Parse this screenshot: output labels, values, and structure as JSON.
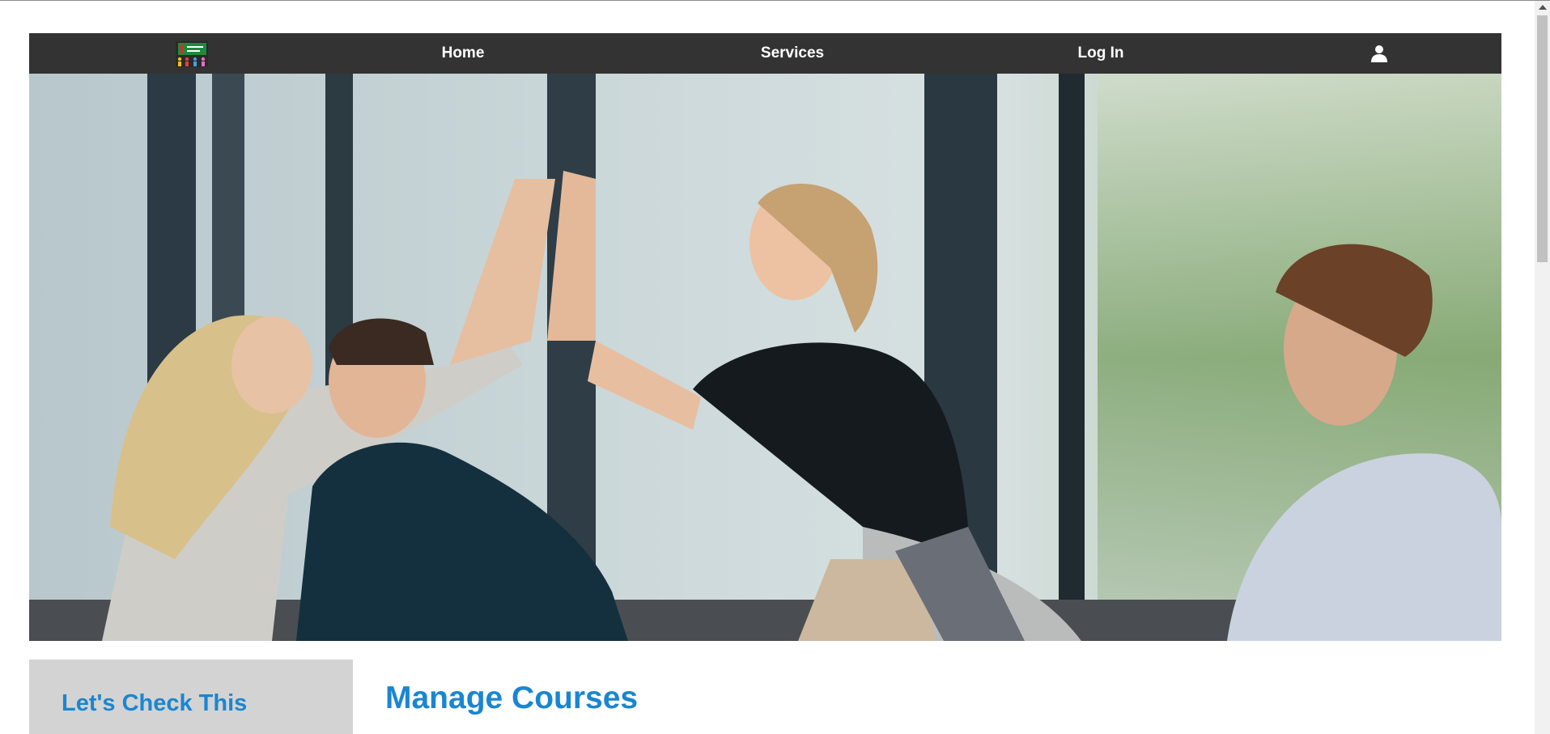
{
  "navbar": {
    "logo_icon": "team-logo-icon",
    "links": {
      "home": "Home",
      "services": "Services",
      "login": "Log In"
    },
    "user_icon": "user-icon",
    "background": "#333333"
  },
  "hero": {
    "image": "team-high-five-photo"
  },
  "sidebar": {
    "title": "Let's Check This"
  },
  "main": {
    "title": "Manage Courses"
  },
  "colors": {
    "accent": "#1a86d0",
    "sidebar_bg": "#d3d3d3"
  }
}
